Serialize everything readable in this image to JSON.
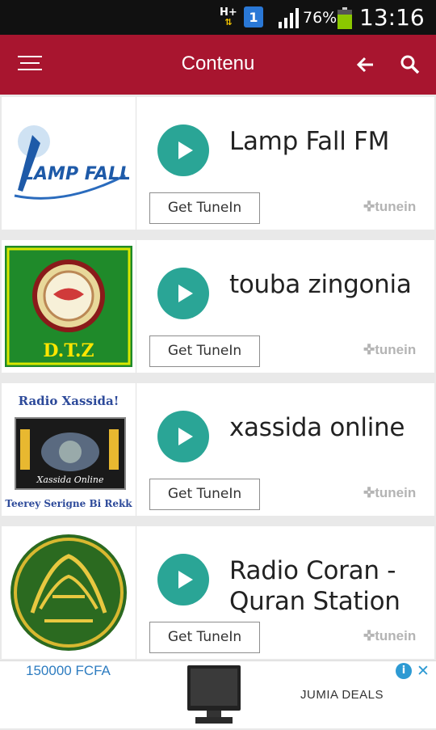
{
  "status_bar": {
    "network": "H+",
    "notification_count": "1",
    "battery_percent": "76%",
    "time": "13:16"
  },
  "toolbar": {
    "title": "Contenu",
    "menu_icon": "menu-icon",
    "back_icon": "back-arrow-icon",
    "search_icon": "search-icon",
    "color": "#a8152f"
  },
  "stations": [
    {
      "name": "Lamp Fall FM",
      "button_label": "Get TuneIn",
      "brand": "✜tunein",
      "logo_text": "LAMP FALL"
    },
    {
      "name": "touba zingonia",
      "button_label": "Get TuneIn",
      "brand": "✜tunein",
      "logo_text": "D.T.Z"
    },
    {
      "name": "xassida online",
      "button_label": "Get TuneIn",
      "brand": "✜tunein",
      "logo_text": "Radio Xassida!",
      "logo_text_2": "Xassida Online",
      "logo_text_3": "Teerey Serigne Bi Rekk"
    },
    {
      "name": "Radio Coran - Quran Station",
      "button_label": "Get TuneIn",
      "brand": "✜tunein",
      "logo_text": ""
    }
  ],
  "ad": {
    "price": "150000 FCFA",
    "brand": "JUMIA DEALS",
    "info_icon": "info-icon",
    "close_icon": "close-icon"
  },
  "accent_color": "#2aa596"
}
